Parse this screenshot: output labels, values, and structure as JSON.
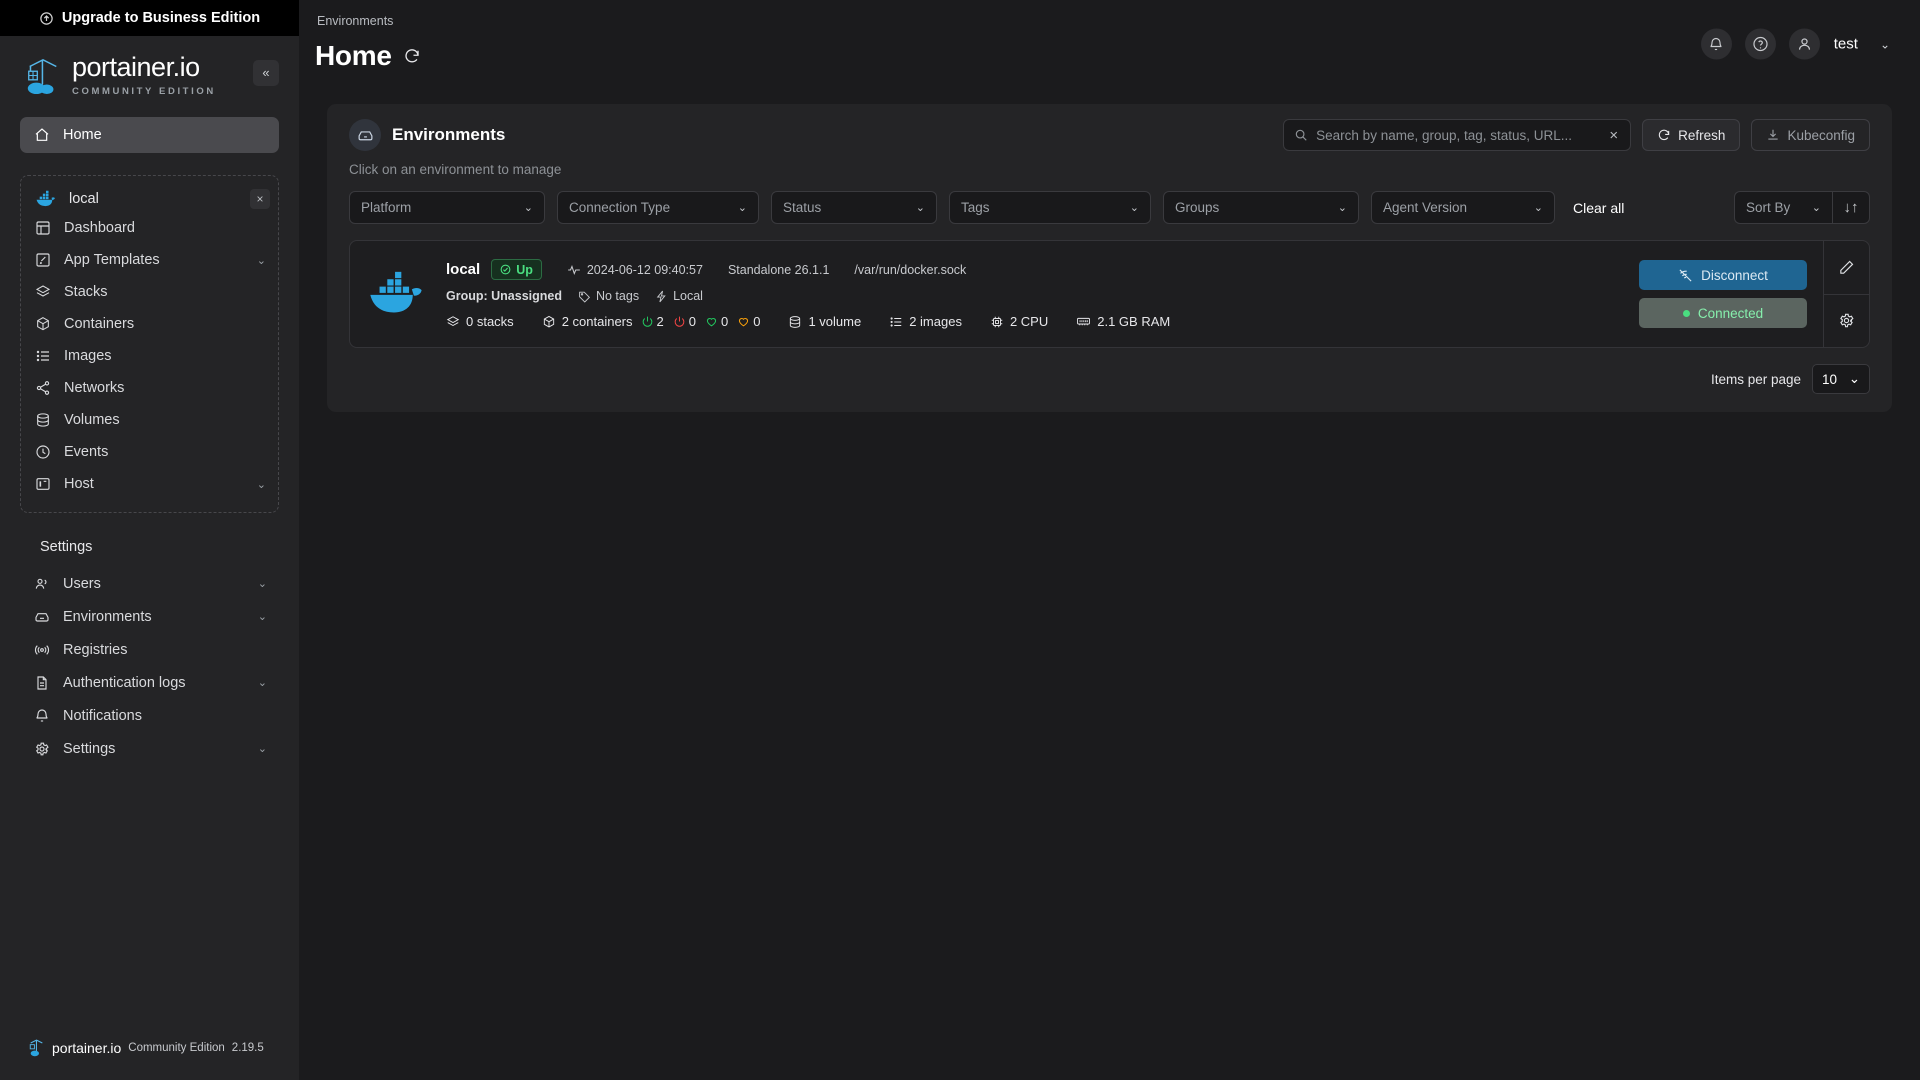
{
  "sidebar": {
    "upgrade_label": "Upgrade to Business Edition",
    "logo_title": "portainer.io",
    "logo_subtitle": "COMMUNITY EDITION",
    "collapse_label": "«",
    "home_label": "Home",
    "environment": {
      "name": "local",
      "close_label": "×"
    },
    "env_items": [
      {
        "label": "Dashboard",
        "chevron": ""
      },
      {
        "label": "App Templates",
        "chevron": "⌄"
      },
      {
        "label": "Stacks",
        "chevron": ""
      },
      {
        "label": "Containers",
        "chevron": ""
      },
      {
        "label": "Images",
        "chevron": ""
      },
      {
        "label": "Networks",
        "chevron": ""
      },
      {
        "label": "Volumes",
        "chevron": ""
      },
      {
        "label": "Events",
        "chevron": ""
      },
      {
        "label": "Host",
        "chevron": "⌄"
      }
    ],
    "settings_label": "Settings",
    "settings_items": [
      {
        "label": "Users",
        "chevron": "⌄"
      },
      {
        "label": "Environments",
        "chevron": "⌄"
      },
      {
        "label": "Registries",
        "chevron": ""
      },
      {
        "label": "Authentication logs",
        "chevron": "⌄"
      },
      {
        "label": "Notifications",
        "chevron": ""
      },
      {
        "label": "Settings",
        "chevron": "⌄"
      }
    ],
    "footer": {
      "name": "portainer.io",
      "edition": "Community Edition",
      "version": "2.19.5"
    }
  },
  "header": {
    "breadcrumb": "Environments",
    "title": "Home",
    "user_name": "test",
    "user_chevron": "⌄"
  },
  "panel": {
    "title": "Environments",
    "hint": "Click on an environment to manage",
    "search": {
      "placeholder": "Search by name, group, tag, status, URL...",
      "value": "",
      "clear_label": "×"
    },
    "refresh_label": "Refresh",
    "kubeconfig_label": "Kubeconfig"
  },
  "filters": {
    "platform": "Platform",
    "connection_type": "Connection Type",
    "status": "Status",
    "tags": "Tags",
    "groups": "Groups",
    "agent_version": "Agent Version",
    "clear_all": "Clear all",
    "sort_by": "Sort By",
    "chevron": "⌄",
    "sort_direction": "↓↑"
  },
  "environment_card": {
    "name": "local",
    "status": "Up",
    "heartbeat": "2024-06-12 09:40:57",
    "engine": "Standalone 26.1.1",
    "url": "/var/run/docker.sock",
    "group": "Group: Unassigned",
    "tags": "No tags",
    "connection": "Local",
    "stats": {
      "stacks": "0 stacks",
      "containers": "2 containers",
      "running": "2",
      "stopped": "0",
      "healthy": "0",
      "unhealthy": "0",
      "volumes": "1 volume",
      "images": "2 images",
      "cpu": "2 CPU",
      "ram": "2.1 GB RAM"
    },
    "disconnect_label": "Disconnect",
    "connected_label": "Connected"
  },
  "pagination": {
    "label": "Items per page",
    "value": "10",
    "chevron": "⌄"
  }
}
